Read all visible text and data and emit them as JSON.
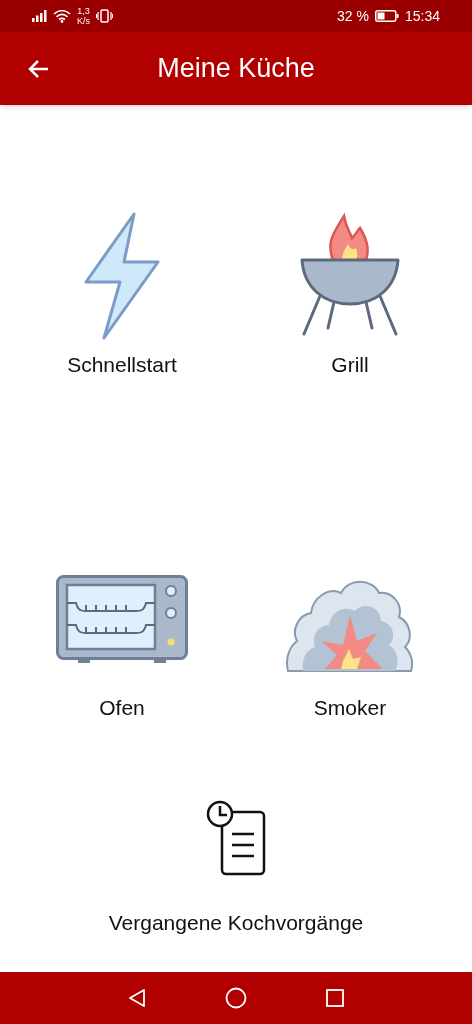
{
  "status_bar": {
    "speed_value": "1,3",
    "speed_unit": "K/s",
    "battery": "32 %",
    "time": "15:34"
  },
  "app_bar": {
    "title": "Meine Küche"
  },
  "tiles": [
    {
      "kind": "bolt",
      "label": "Schnellstart"
    },
    {
      "kind": "grill",
      "label": "Grill"
    },
    {
      "kind": "oven",
      "label": "Ofen"
    },
    {
      "kind": "smoker",
      "label": "Smoker"
    },
    {
      "kind": "history",
      "label": "Vergangene Kochvorgänge"
    }
  ]
}
